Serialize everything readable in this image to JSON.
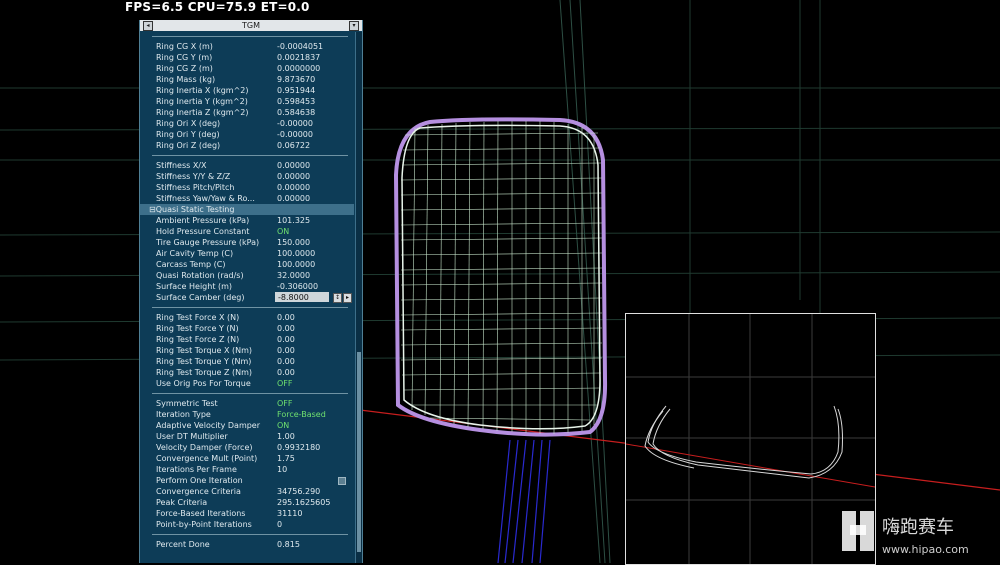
{
  "hud": {
    "text": "FPS=6.5 CPU=75.9 ET=0.0"
  },
  "panel": {
    "title": "TGM",
    "ring_properties": [
      {
        "label": "Ring CG X (m)",
        "value": "-0.0004051"
      },
      {
        "label": "Ring CG Y (m)",
        "value": "0.0021837"
      },
      {
        "label": "Ring CG Z (m)",
        "value": "0.0000000"
      },
      {
        "label": "Ring Mass (kg)",
        "value": "9.873670"
      },
      {
        "label": "Ring Inertia X (kgm^2)",
        "value": "0.951944"
      },
      {
        "label": "Ring Inertia Y (kgm^2)",
        "value": "0.598453"
      },
      {
        "label": "Ring Inertia Z (kgm^2)",
        "value": "0.584638"
      },
      {
        "label": "Ring Ori X (deg)",
        "value": "-0.00000"
      },
      {
        "label": "Ring Ori Y (deg)",
        "value": "-0.00000"
      },
      {
        "label": "Ring Ori Z (deg)",
        "value": "0.06722"
      }
    ],
    "stiffness": [
      {
        "label": "Stiffness X/X",
        "value": "0.00000"
      },
      {
        "label": "Stiffness Y/Y & Z/Z",
        "value": "0.00000"
      },
      {
        "label": "Stiffness Pitch/Pitch",
        "value": "0.00000"
      },
      {
        "label": "Stiffness Yaw/Yaw & Ro...",
        "value": "0.00000"
      }
    ],
    "section_title": "Quasi Static Testing",
    "section_toggle": "⊟",
    "quasi_static": [
      {
        "label": "Ambient Pressure (kPa)",
        "value": "101.325"
      },
      {
        "label": "Hold Pressure Constant",
        "value": "ON",
        "on": true
      },
      {
        "label": "Tire Gauge Pressure (kPa)",
        "value": "150.000"
      },
      {
        "label": "Air Cavity Temp (C)",
        "value": "100.0000"
      },
      {
        "label": "Carcass Temp (C)",
        "value": "100.0000"
      },
      {
        "label": "Quasi Rotation (rad/s)",
        "value": "32.0000"
      },
      {
        "label": "Surface Height (m)",
        "value": "-0.306000"
      }
    ],
    "surface_camber": {
      "label": "Surface Camber (deg)",
      "value": "-8.8000"
    },
    "ring_test": [
      {
        "label": "Ring Test Force X (N)",
        "value": "0.00"
      },
      {
        "label": "Ring Test Force Y (N)",
        "value": "0.00"
      },
      {
        "label": "Ring Test Force Z (N)",
        "value": "0.00"
      },
      {
        "label": "Ring Test Torque X (Nm)",
        "value": "0.00"
      },
      {
        "label": "Ring Test Torque Y (Nm)",
        "value": "0.00"
      },
      {
        "label": "Ring Test Torque Z (Nm)",
        "value": "0.00"
      },
      {
        "label": "Use Orig Pos For Torque",
        "value": "OFF",
        "on": true
      }
    ],
    "iteration_a": [
      {
        "label": "Symmetric Test",
        "value": "OFF",
        "on": true
      },
      {
        "label": "Iteration Type",
        "value": "Force-Based",
        "on": true
      },
      {
        "label": "Adaptive Velocity Damper",
        "value": "ON",
        "on": true
      },
      {
        "label": "User DT Multiplier",
        "value": "1.00"
      },
      {
        "label": "Velocity Damper (Force)",
        "value": "0.9932180"
      },
      {
        "label": "Convergence Mult (Point)",
        "value": "1.75"
      },
      {
        "label": "Iterations Per Frame",
        "value": "10"
      }
    ],
    "perform_one_iteration": {
      "label": "Perform One Iteration"
    },
    "iteration_b": [
      {
        "label": "Convergence Criteria",
        "value": "34756.290"
      },
      {
        "label": "Peak Criteria",
        "value": "295.1625605"
      },
      {
        "label": "Force-Based Iterations",
        "value": "31110"
      },
      {
        "label": "Point-by-Point Iterations",
        "value": "0"
      }
    ],
    "percent_done": {
      "label": "Percent Done",
      "value": "0.815"
    }
  },
  "watermark": {
    "text": "嗨跑赛车",
    "url": "www.hipao.com"
  },
  "colors": {
    "panel": "#0d3c57",
    "section": "#3d6f8a",
    "on_value": "#6fe06f",
    "mesh_green": "#bfe3c3",
    "mesh_purple": "#b58fe0",
    "road_line": "#d02020"
  }
}
